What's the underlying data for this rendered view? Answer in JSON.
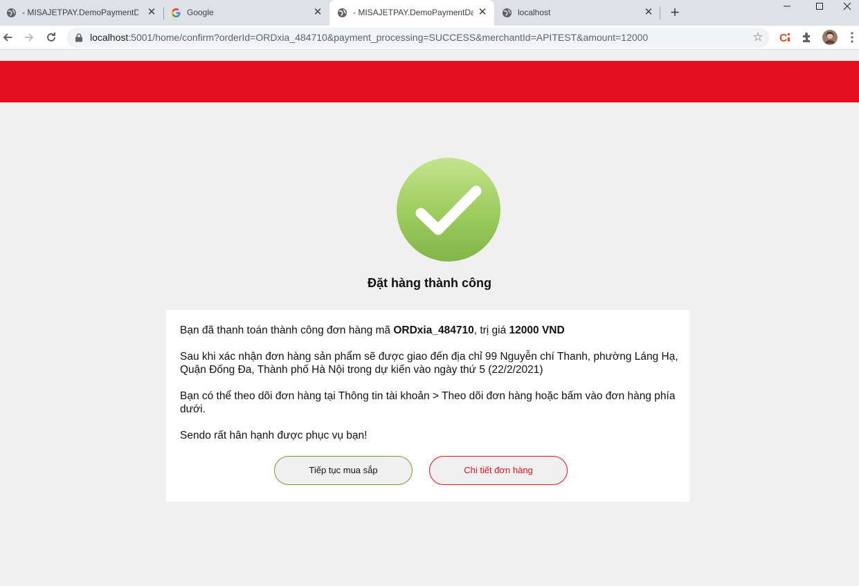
{
  "browser": {
    "tabs": [
      {
        "title": "- MISAJETPAY.DemoPaymentDat",
        "icon": "globe-icon",
        "active": false
      },
      {
        "title": "Google",
        "icon": "google-icon",
        "active": false
      },
      {
        "title": "- MISAJETPAY.DemoPaymentDat",
        "icon": "globe-icon",
        "active": true
      },
      {
        "title": "localhost",
        "icon": "globe-icon",
        "active": false
      }
    ],
    "new_tab_label": "+",
    "window_controls": {
      "minimize": "—",
      "maximize": "☐",
      "close": "✕"
    },
    "url_host": "localhost",
    "url_rest": ":5001/home/confirm?orderId=ORDxia_484710&payment_processing=SUCCESS&merchantId=APITEST&amount=12000"
  },
  "page": {
    "header_color": "#e3111f",
    "success_title": "Đặt hàng thành công",
    "message": {
      "line1_prefix": "Bạn đã thanh toán thành công đơn hàng mã ",
      "order_id": "ORDxia_484710",
      "line1_mid": ", trị giá ",
      "amount": "12000 VND",
      "line2": "Sau khi xác nhận đơn hàng sản phẩm sẽ được giao đến địa chỉ 99 Nguyễn chí Thanh, phường Láng Hạ, Quận Đống Đa, Thành phố Hà Nội trong dự kiến vào ngày thứ 5 (22/2/2021)",
      "line3": "Bạn có thể theo dõi đơn hàng tại Thông tin tài khoản > Theo dõi đơn hàng hoặc bấm vào đơn hàng phía dưới.",
      "line4": "Sendo rất hân hạnh được phục vụ bạn!"
    },
    "buttons": {
      "continue_shopping": "Tiếp tục mua sắp",
      "order_detail": "Chi tiết đơn hàng"
    }
  }
}
